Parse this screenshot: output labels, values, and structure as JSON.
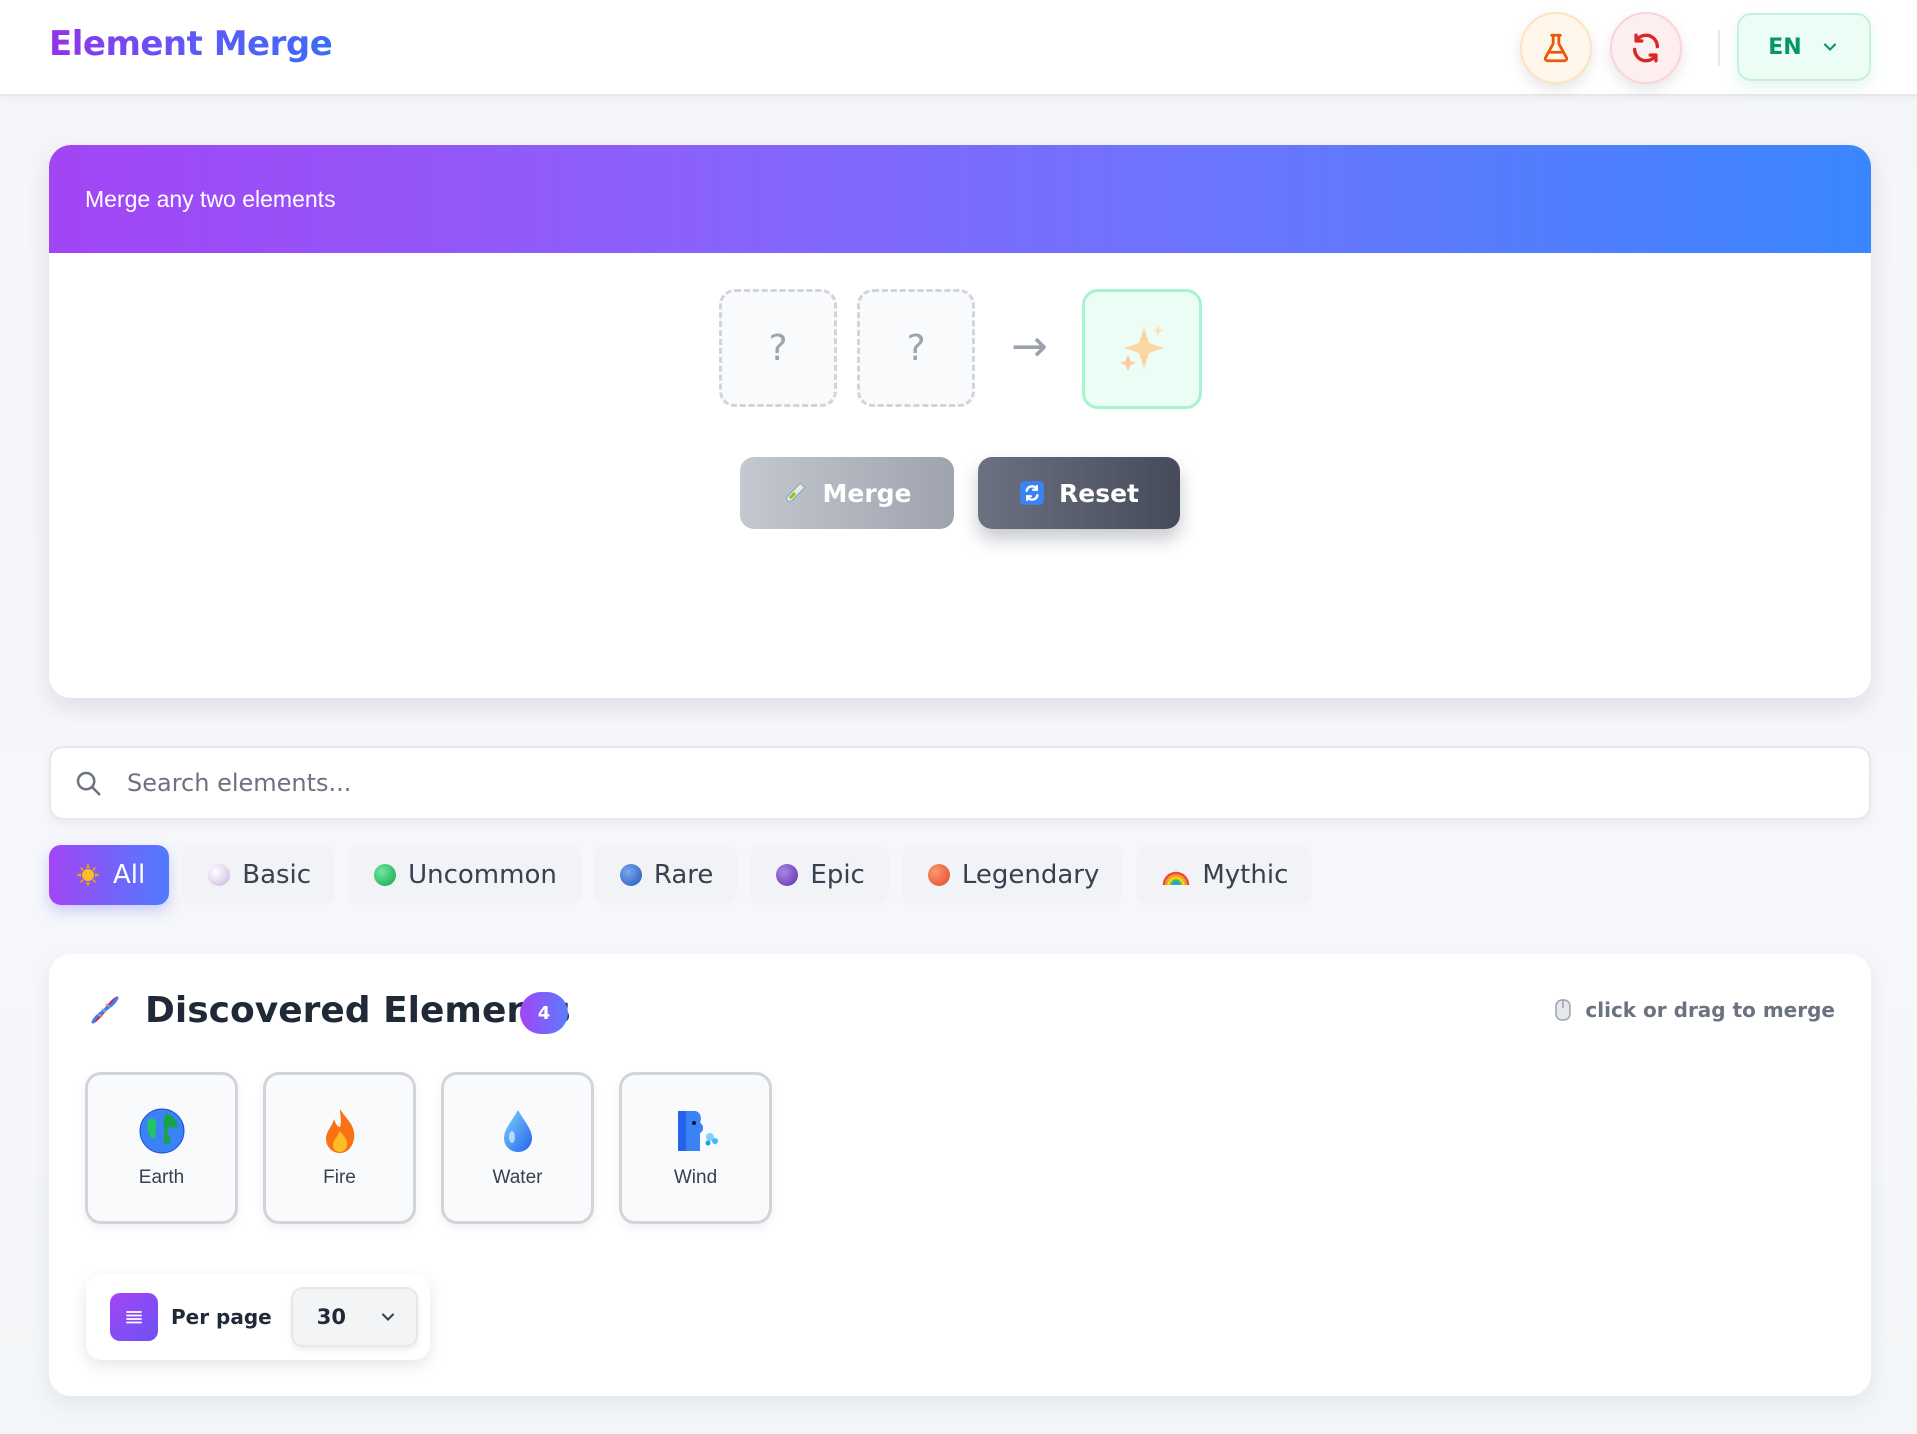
{
  "app": {
    "title": "Element Merge"
  },
  "header": {
    "language": "EN",
    "lab_icon": "flask-icon",
    "refresh_icon": "refresh-icon"
  },
  "merge": {
    "prompt": "Merge any two elements",
    "slot_a": "?",
    "slot_b": "?",
    "arrow": "→",
    "result_icon": "sparkles-icon",
    "merge_label": "Merge",
    "merge_icon": "test-tube-icon",
    "reset_label": "Reset",
    "reset_icon": "repeat-icon"
  },
  "search": {
    "placeholder": "Search elements..."
  },
  "filters": [
    {
      "label": "All",
      "icon": "sun-icon",
      "active": true
    },
    {
      "label": "Basic",
      "color": "#d8c8ee"
    },
    {
      "label": "Uncommon",
      "color": "#22c55e"
    },
    {
      "label": "Rare",
      "color": "#3b6fd8"
    },
    {
      "label": "Epic",
      "color": "#7c4dc9"
    },
    {
      "label": "Legendary",
      "color": "#f0643a"
    },
    {
      "label": "Mythic",
      "icon": "rainbow-icon"
    }
  ],
  "discovered": {
    "title": "Discovered Elements",
    "count": "4",
    "hint": "click or drag to merge",
    "items": [
      {
        "name": "Earth",
        "icon": "globe-icon"
      },
      {
        "name": "Fire",
        "icon": "fire-icon"
      },
      {
        "name": "Water",
        "icon": "droplet-icon"
      },
      {
        "name": "Wind",
        "icon": "wind-face-icon"
      }
    ]
  },
  "pagination": {
    "label": "Per page",
    "value": "30"
  },
  "colors": {
    "brand_gradient_start": "#a245f5",
    "brand_gradient_end": "#3a86fe",
    "reset_button": "#4b5160",
    "language_accent": "#059669"
  }
}
